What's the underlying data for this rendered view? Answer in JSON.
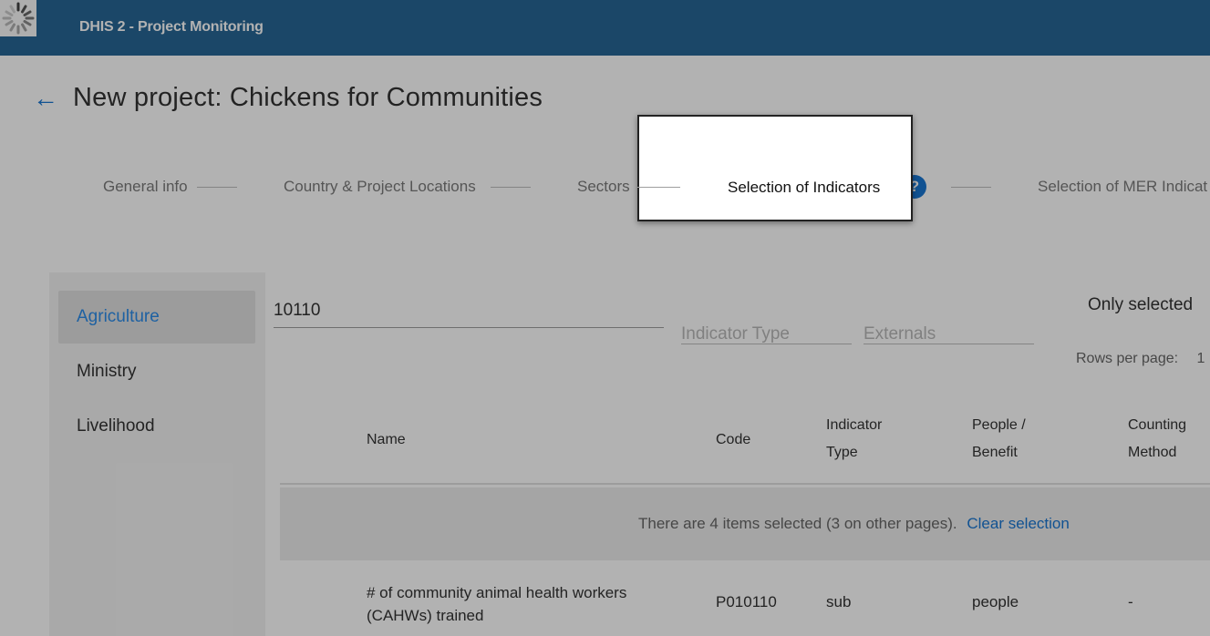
{
  "header": {
    "app_title": "DHIS 2 - Project Monitoring",
    "logo_icon": "loading-spinner-icon",
    "color": "#276696"
  },
  "page": {
    "title": "New project: Chickens for Communities",
    "back_icon": "arrow-left-icon"
  },
  "stepper": {
    "steps": [
      {
        "label": "General info"
      },
      {
        "label": "Country & Project Locations"
      },
      {
        "label": "Sectors"
      },
      {
        "label": "Selection of Indicators",
        "active": true
      },
      {
        "label": "Selection of MER Indicat"
      }
    ],
    "help_icon": "?"
  },
  "sidebar": {
    "items": [
      {
        "label": "Agriculture",
        "active": true
      },
      {
        "label": "Ministry"
      },
      {
        "label": "Livelihood"
      }
    ]
  },
  "filters": {
    "search_value": "10110",
    "indicator_type_placeholder": "Indicator Type",
    "externals_placeholder": "Externals",
    "only_selected_label": "Only selected",
    "rows_per_page_label": "Rows per page:",
    "rows_per_page_value": "1"
  },
  "table": {
    "columns": [
      {
        "label": "Name"
      },
      {
        "label": "Code"
      },
      {
        "label": "Indicator Type"
      },
      {
        "label": "People / Benefit"
      },
      {
        "label": "Counting Method"
      }
    ],
    "selection_banner": {
      "text": "There are 4 items selected (3 on other pages).",
      "clear_label": "Clear selection"
    },
    "rows": [
      {
        "name": "# of community animal health workers (CAHWs) trained",
        "code": "P010110",
        "indicator_type": "sub",
        "people_benefit": "people",
        "counting_method": "-"
      }
    ]
  },
  "colors": {
    "accent": "#1976d2",
    "active_sidebar_text": "#2b8be8"
  }
}
